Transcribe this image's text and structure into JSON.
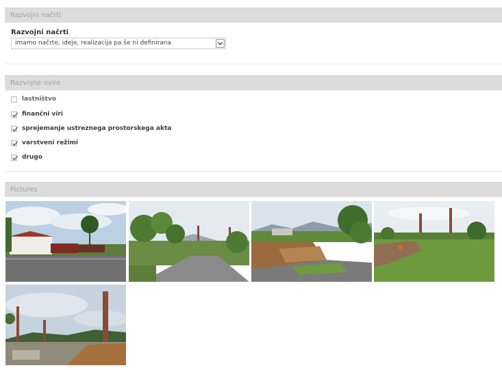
{
  "sections": {
    "development_plans": {
      "header": "Razvojni načrti",
      "field_label": "Razvojni načrti",
      "select_value": "imamo načrte, ideje, realizacija pa še ni definirana"
    },
    "development_barriers": {
      "header": "Razvojne ovire",
      "items": [
        {
          "label": "lastništvo",
          "checked": false
        },
        {
          "label": "finančni viri",
          "checked": true
        },
        {
          "label": "sprejemanje ustreznega prostorskega akta",
          "checked": true
        },
        {
          "label": "varstveni režimi",
          "checked": true
        },
        {
          "label": "drugo",
          "checked": true
        }
      ]
    },
    "pictures": {
      "header": "Pictures",
      "count": 5
    }
  },
  "colors": {
    "header_bg": "#dcdcdc",
    "header_text": "#a0a0a0",
    "sky": "#c9d6e4",
    "grass": "#5c8a35",
    "asphalt": "#6f6f6f",
    "chimney": "#8a4a36"
  },
  "icons": {
    "dropdown": "chevron-down-icon",
    "checkmark": "check-icon"
  }
}
